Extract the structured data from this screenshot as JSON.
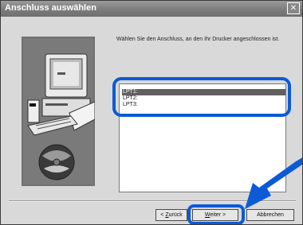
{
  "window": {
    "title": "Anschluss auswählen",
    "close_glyph": "✕"
  },
  "content": {
    "description": "Wählen Sie den Anschluss, an den Ihr Drucker angeschlossen ist."
  },
  "ports": {
    "items": [
      "LPT1:",
      "LPT2:",
      "LPT3:"
    ],
    "selected": "LPT1:"
  },
  "buttons": {
    "back": "< Zurück",
    "next": "Weiter >",
    "cancel": "Abbrechen"
  },
  "colors": {
    "highlight": "#0c5ad6",
    "selection": "#606060"
  },
  "icons": [
    "computer-illustration",
    "cd-disc-icon",
    "pointer-arrow-icon"
  ]
}
